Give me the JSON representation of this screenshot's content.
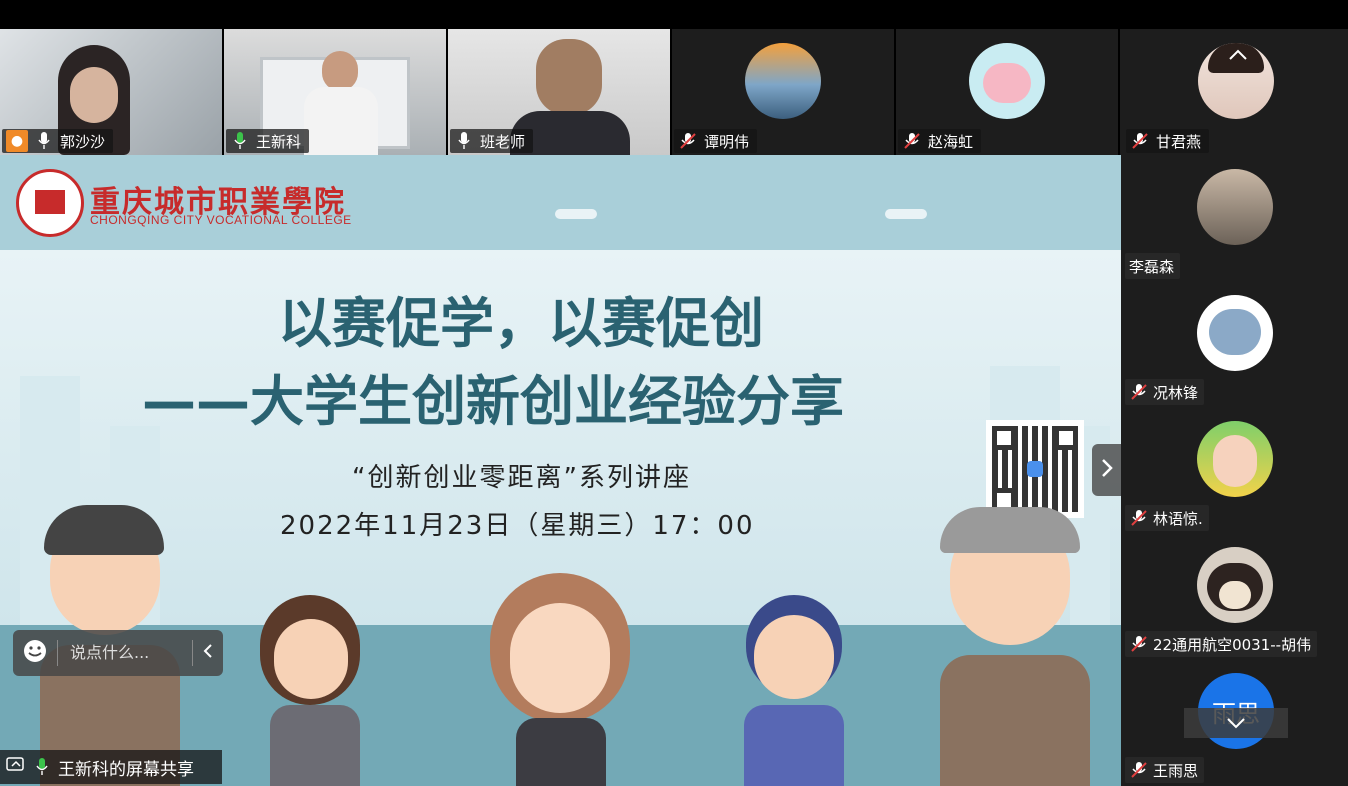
{
  "participants_top": [
    {
      "name": "郭沙沙",
      "mic": "on"
    },
    {
      "name": "王新科",
      "mic": "on"
    },
    {
      "name": "班老师",
      "mic": "on"
    },
    {
      "name": "谭明伟",
      "mic": "muted"
    },
    {
      "name": "赵海虹",
      "mic": "muted"
    },
    {
      "name": "甘君燕",
      "mic": "muted"
    }
  ],
  "participants_side": [
    {
      "name": "李磊森",
      "mic": "none"
    },
    {
      "name": "况林锋",
      "mic": "muted"
    },
    {
      "name": "林语惊.",
      "mic": "muted"
    },
    {
      "name": "22通用航空0031--胡伟",
      "mic": "muted"
    },
    {
      "name": "王雨思",
      "mic": "muted",
      "avatar_text": "雨思"
    }
  ],
  "slide": {
    "college_cn": "重庆城市职業學院",
    "college_en": "CHONGQING CITY VOCATIONAL COLLEGE",
    "title_line1": "以赛促学，以赛促创",
    "title_line2": "——大学生创新创业经验分享",
    "series": "“创新创业零距离”系列讲座",
    "datetime": "2022年11月23日（星期三）17：00"
  },
  "chat": {
    "placeholder": "说点什么..."
  },
  "share_label": "王新科的屏幕共享",
  "colors": {
    "title": "#2a6271",
    "accent": "#c72b2b",
    "mic_on": "#3cc34b",
    "muted": "#e04040",
    "avatar_blue": "#1a74e8"
  }
}
